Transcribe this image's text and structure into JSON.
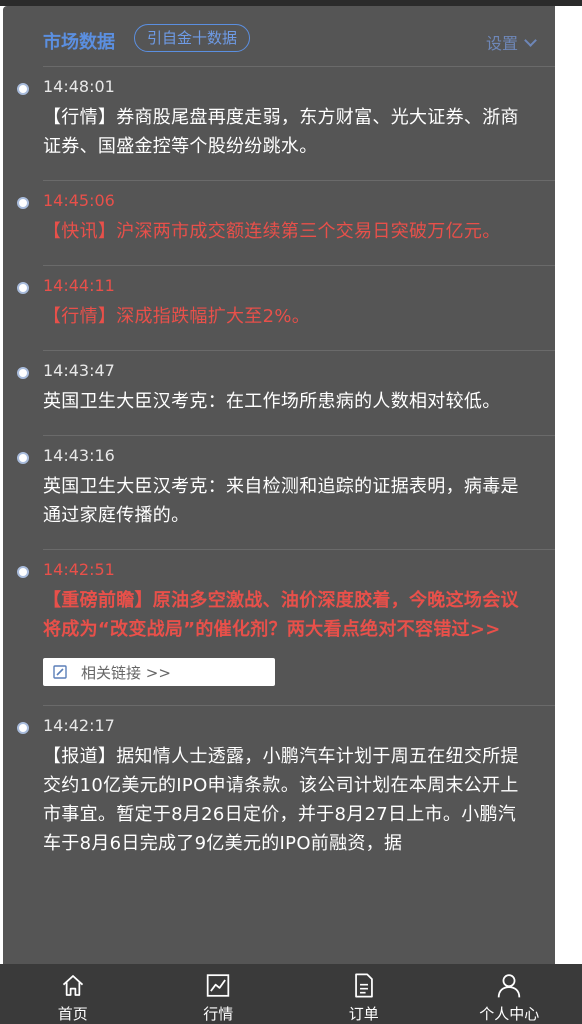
{
  "header": {
    "title": "市场数据",
    "source_badge": "引自金十数据",
    "settings_label": "设置"
  },
  "feed": [
    {
      "time": "14:48:01",
      "text": "【行情】券商股尾盘再度走弱，东方财富、光大证券、浙商证券、国盛金控等个股纷纷跳水。",
      "style": "normal"
    },
    {
      "time": "14:45:06",
      "text": "【快讯】沪深两市成交额连续第三个交易日突破万亿元。",
      "style": "red"
    },
    {
      "time": "14:44:11",
      "text": "【行情】深成指跌幅扩大至2%。",
      "style": "red"
    },
    {
      "time": "14:43:47",
      "text": "英国卫生大臣汉考克：在工作场所患病的人数相对较低。",
      "style": "normal"
    },
    {
      "time": "14:43:16",
      "text": "英国卫生大臣汉考克：来自检测和追踪的证据表明，病毒是通过家庭传播的。",
      "style": "normal"
    },
    {
      "time": "14:42:51",
      "text": "【重磅前瞻】原油多空激战、油价深度胶着，今晚这场会议将成为“改变战局”的催化剂？两大看点绝对不容错过>>",
      "style": "red-bold",
      "link_label": "相关链接 >>"
    },
    {
      "time": "14:42:17",
      "text": "【报道】据知情人士透露，小鹏汽车计划于周五在纽交所提交约10亿美元的IPO申请条款。该公司计划在本周末公开上市事宜。暂定于8月26日定价，并于8月27日上市。小鹏汽车于8月6日完成了9亿美元的IPO前融资，据",
      "style": "normal"
    }
  ],
  "bottom_nav": [
    {
      "label": "首页",
      "icon": "home-icon"
    },
    {
      "label": "行情",
      "icon": "chart-icon"
    },
    {
      "label": "订单",
      "icon": "document-icon"
    },
    {
      "label": "个人中心",
      "icon": "user-icon"
    }
  ],
  "colors": {
    "panel_bg": "#555555",
    "accent_blue": "#5b8fe0",
    "alert_red": "#e8504a",
    "nav_bg": "#3a3a3a"
  }
}
